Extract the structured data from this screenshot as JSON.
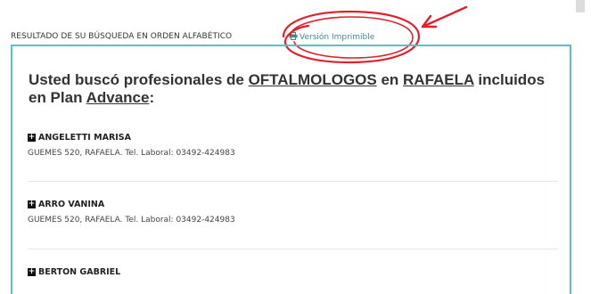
{
  "header": {
    "label": "RESULTADO DE SU BÚSQUEDA EN ORDEN ALFABÉTICO",
    "print_link": "Versión Imprimible"
  },
  "headline": {
    "prefix": "Usted buscó profesionales de ",
    "specialty": "OFTALMOLOGOS",
    "mid": " en ",
    "city": "RAFAELA",
    "suffix1": " incluidos en Plan ",
    "plan": "Advance",
    "suffix2": ":"
  },
  "results": [
    {
      "name": "ANGELETTI MARISA",
      "address": "GUEMES 520, RAFAELA. Tel. Laboral: 03492-424983"
    },
    {
      "name": "ARRO VANINA",
      "address": "GUEMES 520, RAFAELA. Tel. Laboral: 03492-424983"
    },
    {
      "name": "BERTON GABRIEL",
      "address": ""
    }
  ],
  "colors": {
    "accent": "#57c1c9",
    "annotation": "#e0202a",
    "link": "#3f8a8f"
  },
  "icons": {
    "print": "printer-icon",
    "expand": "plus-square-icon"
  }
}
